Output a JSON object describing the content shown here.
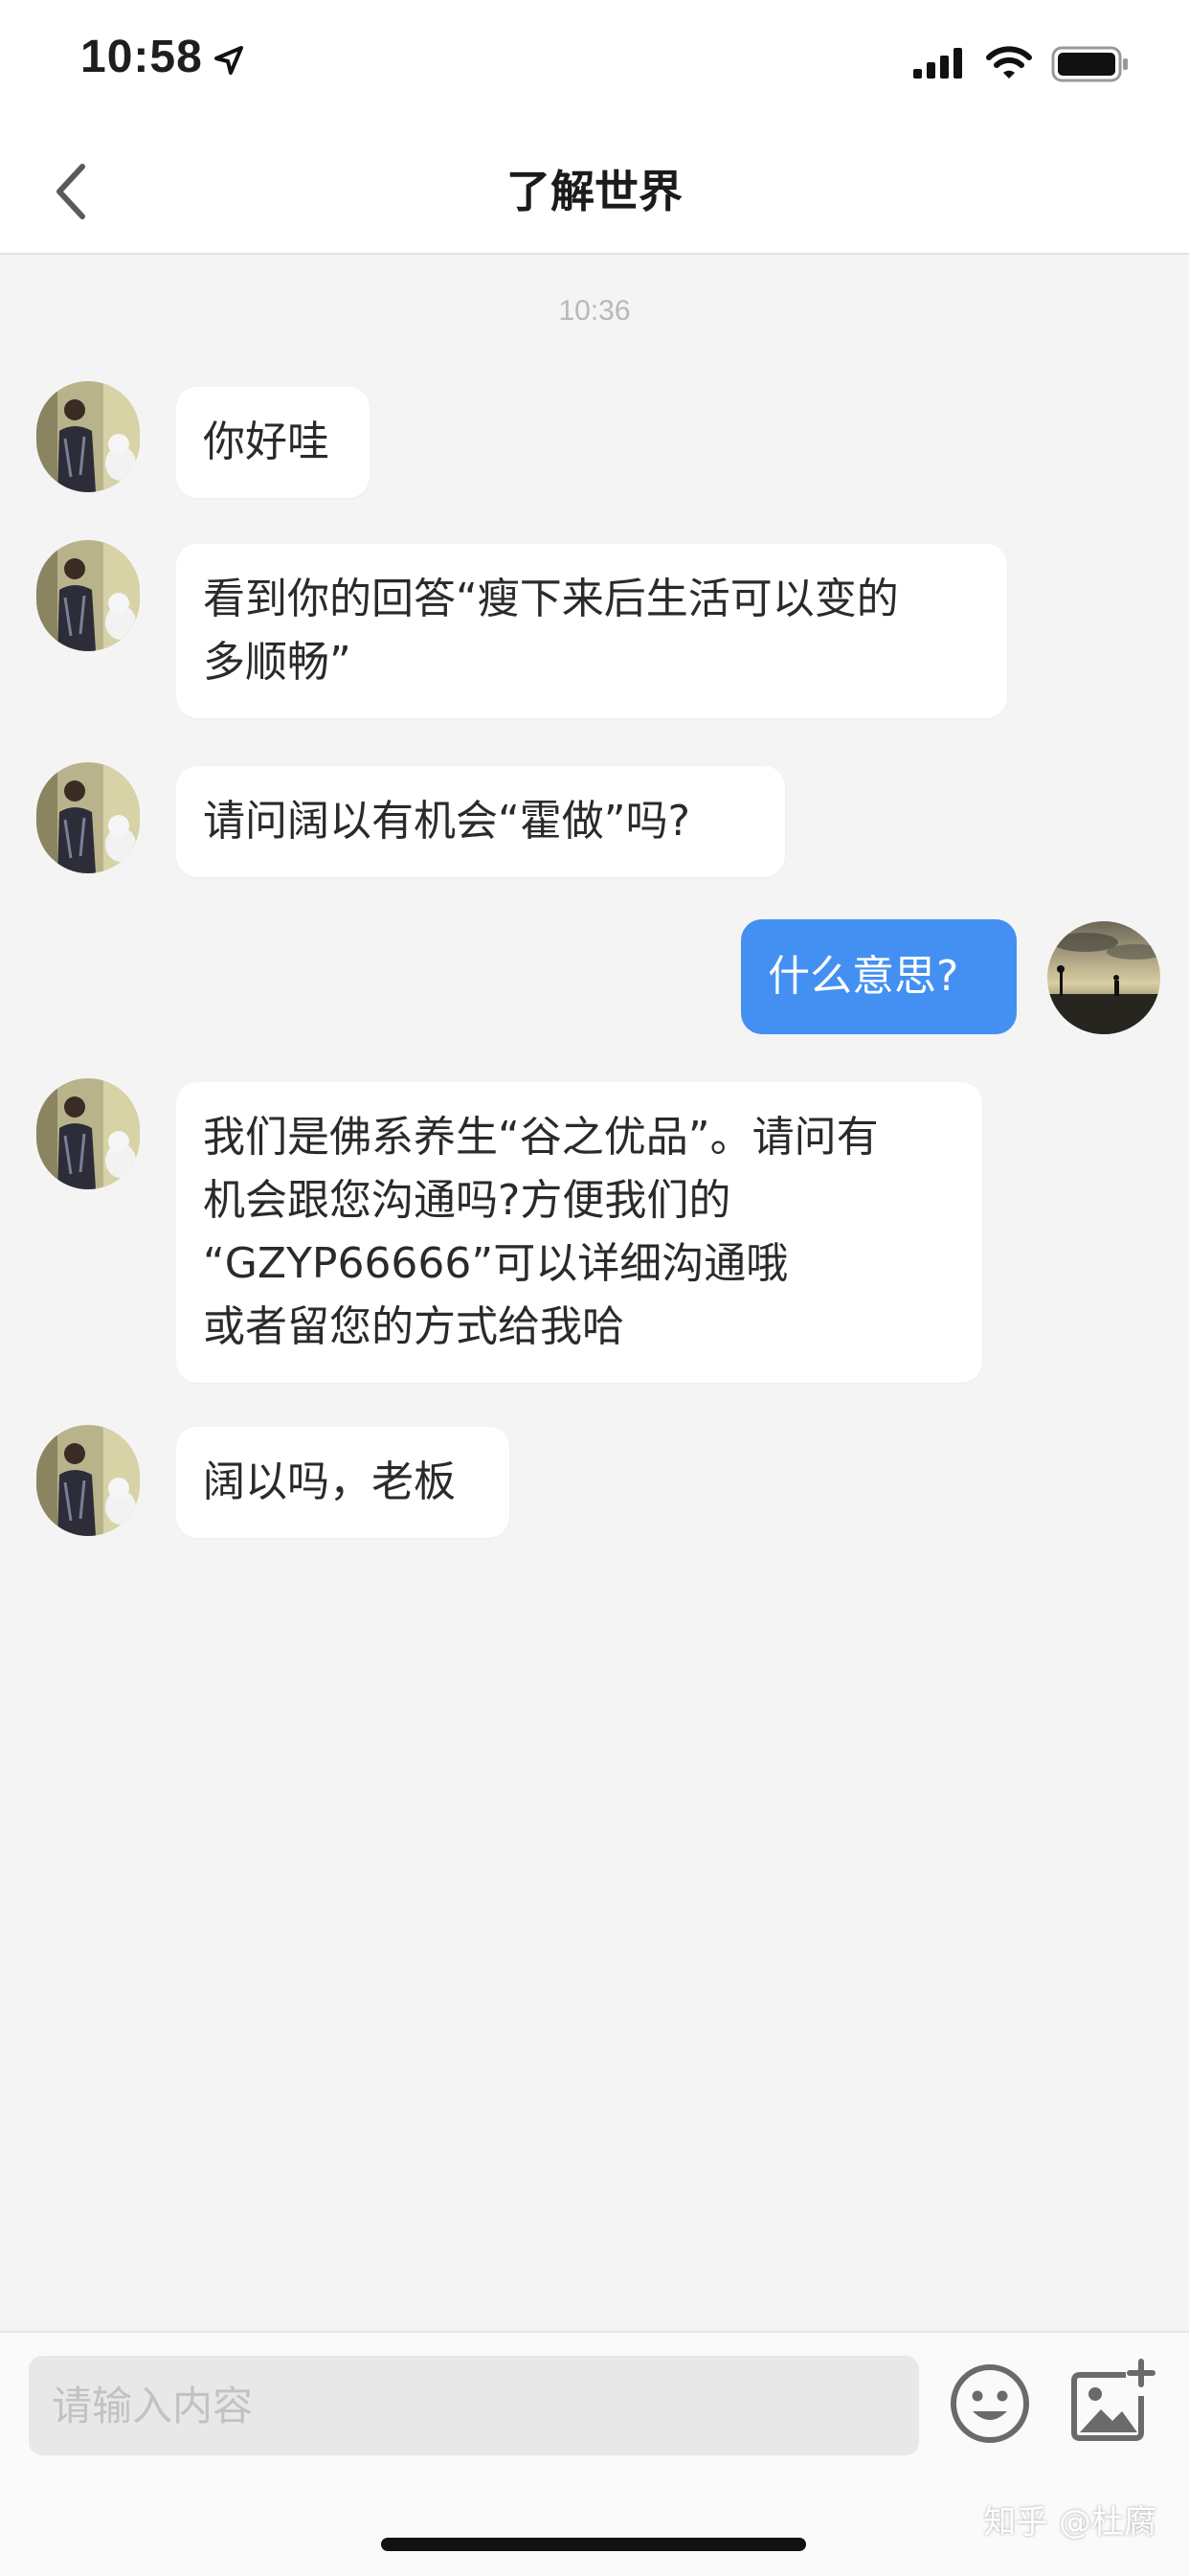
{
  "status_bar": {
    "time": "10:58",
    "icons": [
      "location-arrow-icon",
      "cellular-signal-icon",
      "wifi-icon",
      "battery-icon"
    ]
  },
  "nav": {
    "back_icon": "chevron-left-icon",
    "title": "了解世界"
  },
  "chat": {
    "timestamp": "10:36",
    "messages": [
      {
        "sender": "other",
        "text": "你好哇"
      },
      {
        "sender": "other",
        "text": "看到你的回答“瘦下来后生活可以变的\n多顺畅”"
      },
      {
        "sender": "other",
        "text": "请问阔以有机会“霍做”吗?"
      },
      {
        "sender": "self",
        "text": "什么意思?"
      },
      {
        "sender": "other",
        "text": "我们是佛系养生“谷之优品”。请问有\n机会跟您沟通吗?方便我们的\n“GZYP66666”可以详细沟通哦\n或者留您的方式给我哈"
      },
      {
        "sender": "other",
        "text": "阔以吗，老板"
      }
    ]
  },
  "input_bar": {
    "placeholder": "请输入内容",
    "emoji_icon": "smiley-face-icon",
    "image_icon": "add-image-icon"
  },
  "watermark": "知乎 @杜腐",
  "colors": {
    "self_bubble": "#4390f2",
    "other_bubble": "#ffffff",
    "background": "#f4f4f4"
  }
}
